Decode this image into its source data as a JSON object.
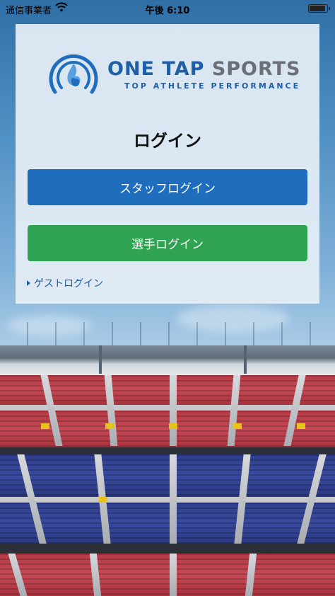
{
  "status_bar": {
    "carrier": "通信事業者",
    "time": "午後 6:10"
  },
  "logo": {
    "name_part1": "ONE TAP ",
    "name_part2": "SPORTS",
    "tagline": "TOP ATHLETE PERFORMANCE"
  },
  "login": {
    "title": "ログイン",
    "staff_button": "スタッフログイン",
    "player_button": "選手ログイン",
    "guest_link": "ゲストログイン"
  },
  "colors": {
    "brand_blue": "#1f6dbd",
    "player_green": "#2fa352",
    "panel_bg": "#e3ecf4"
  }
}
